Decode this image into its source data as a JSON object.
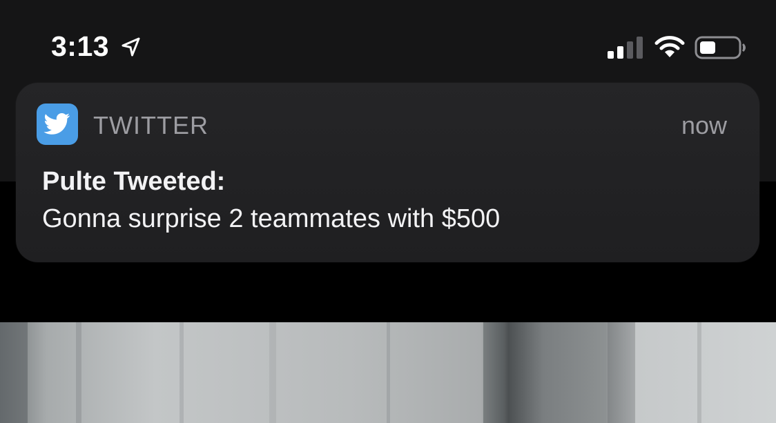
{
  "status_bar": {
    "time": "3:13",
    "icons": [
      "location-arrow-icon",
      "cellular-signal-icon",
      "wifi-icon",
      "battery-icon"
    ]
  },
  "notification": {
    "app_name": "TWITTER",
    "app_icon": "twitter-bird-icon",
    "timestamp": "now",
    "title": "Pulte Tweeted:",
    "body": "Gonna surprise 2 teammates with $500"
  },
  "colors": {
    "twitter_blue": "#4a9de6",
    "banner_bg": "#232325",
    "secondary_text": "#9d9da2",
    "primary_text": "#f2f2f4"
  }
}
